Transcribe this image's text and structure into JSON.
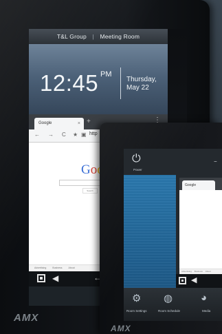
{
  "large_panel": {
    "title_company": "T&L Group",
    "title_separator": "|",
    "title_room": "Meeting Room",
    "time": "12:45",
    "ampm": "PM",
    "day": "Thursday,",
    "date": "May 22",
    "browser": {
      "tab_label": "Google",
      "tab_close": "×",
      "new_tab": "+",
      "menu": "⋮",
      "url": "http",
      "logo_letters": [
        "G",
        "o",
        "o",
        "g",
        "l",
        "e"
      ],
      "logo_colors": [
        "#3b6fd6",
        "#d84135",
        "#f0b400",
        "#3b6fd6",
        "#1e9e4e",
        "#d84135"
      ],
      "search_button": "Search",
      "footer_links": [
        "Advertising",
        "Business",
        "About"
      ]
    },
    "brand": "AMX"
  },
  "small_panel": {
    "power_label": "Power",
    "browser_tab": "Google",
    "footer_links": [
      "Advertising",
      "Business",
      "About"
    ],
    "bottom_items": [
      {
        "icon": "⚙",
        "label": "Room Settings"
      },
      {
        "icon": "◍",
        "label": "Room Schedule"
      },
      {
        "icon": "◕",
        "label": "Media"
      }
    ],
    "brand": "AMX"
  }
}
